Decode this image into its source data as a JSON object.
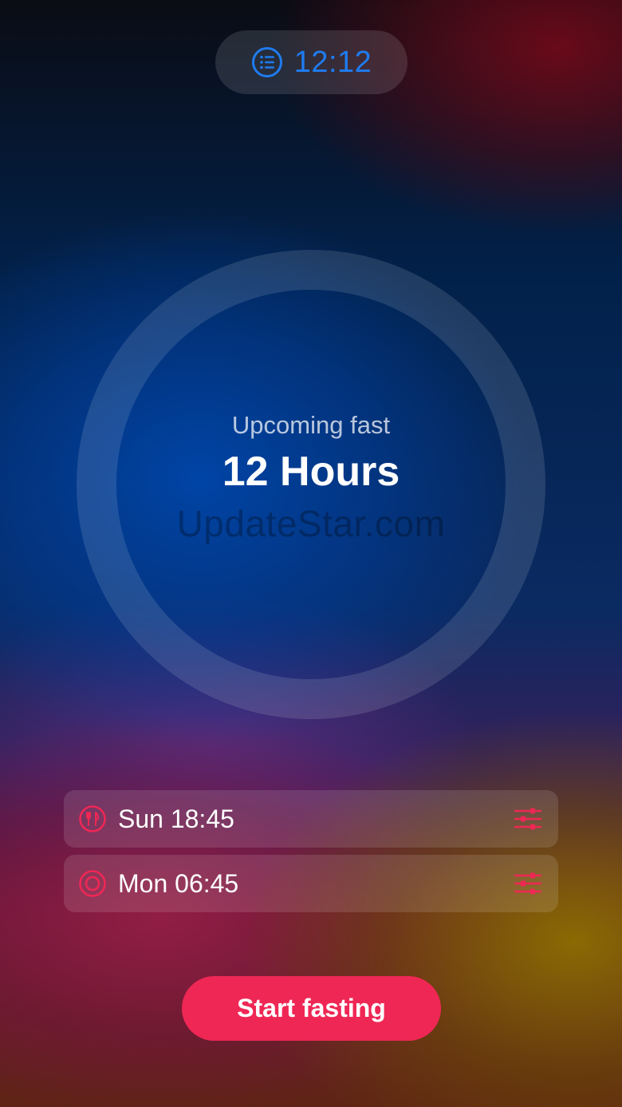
{
  "header": {
    "clock_icon": "list-icon",
    "clock_time": "12:12"
  },
  "fast": {
    "label": "Upcoming fast",
    "duration": "12 Hours",
    "watermark": "UpdateStar.com"
  },
  "schedule": {
    "start": {
      "icon": "fork-knife-icon",
      "time": "Sun 18:45",
      "adjust_icon": "sliders-icon"
    },
    "end": {
      "icon": "target-icon",
      "time": "Mon 06:45",
      "adjust_icon": "sliders-icon"
    }
  },
  "actions": {
    "start_label": "Start fasting"
  },
  "colors": {
    "accent": "#ef2755",
    "clock_blue": "#1f7cf0"
  }
}
